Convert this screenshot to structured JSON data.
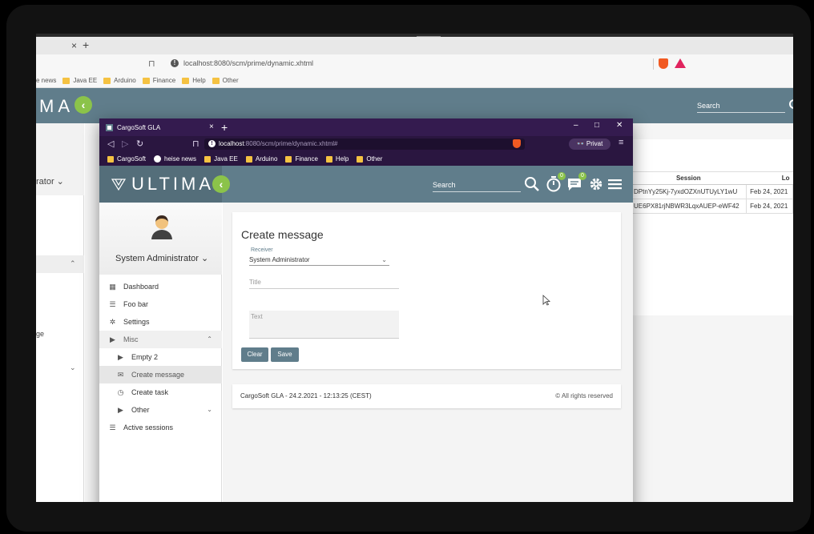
{
  "background_browser": {
    "tab_close": "×",
    "tab_add": "+",
    "url": "localhost:8080/scm/prime/dynamic.xhtml",
    "bookmarks": [
      "e news",
      "Java EE",
      "Arduino",
      "Finance",
      "Help",
      "Other"
    ],
    "logo": "MA",
    "search_label": "Search",
    "sidebar_user": "rator",
    "sidebar_ge": "ge",
    "session_table": {
      "headers": [
        "Session",
        "Lo"
      ],
      "rows": [
        [
          "DPtnYy25Kj-7yxdOZXnUTUyLY1wU",
          "Feb 24, 2021"
        ],
        [
          "UE6PX81rjNBWR3LqxAUEP-eWF42",
          "Feb 24, 2021"
        ]
      ]
    }
  },
  "window": {
    "tab_title": "CargoSoft GLA",
    "tab_close": "×",
    "tab_add": "+",
    "controls": [
      "–",
      "□",
      "✕"
    ],
    "url_host": "localhost",
    "url_path": ":8080/scm/prime/dynamic.xhtml#",
    "privat_label": "Privat",
    "bookmarks": [
      {
        "label": "CargoSoft",
        "icon": "folder"
      },
      {
        "label": "heise news",
        "icon": "circle"
      },
      {
        "label": "Java EE",
        "icon": "folder"
      },
      {
        "label": "Arduino",
        "icon": "folder"
      },
      {
        "label": "Finance",
        "icon": "folder"
      },
      {
        "label": "Help",
        "icon": "folder"
      },
      {
        "label": "Other",
        "icon": "folder"
      }
    ]
  },
  "app": {
    "logo": "ULTIMA",
    "search_label": "Search",
    "timer_badge": "0",
    "messages_badge": "0",
    "user_name": "System Administrator",
    "menu": [
      {
        "label": "Dashboard",
        "icon": "dashboard-icon"
      },
      {
        "label": "Foo bar",
        "icon": "list-icon"
      },
      {
        "label": "Settings",
        "icon": "gear-icon"
      },
      {
        "label": "Misc",
        "icon": "label-icon"
      },
      {
        "label": "Empty 2",
        "icon": "label-icon"
      },
      {
        "label": "Create message",
        "icon": "mail-icon"
      },
      {
        "label": "Create task",
        "icon": "clock-icon"
      },
      {
        "label": "Other",
        "icon": "label-icon"
      },
      {
        "label": "Active sessions",
        "icon": "list-icon"
      }
    ],
    "form": {
      "title": "Create message",
      "receiver_label": "Receiver",
      "receiver_value": "System Administrator",
      "title_placeholder": "Title",
      "text_placeholder": "Text",
      "clear_label": "Clear",
      "save_label": "Save"
    },
    "footer": {
      "left": "CargoSoft GLA - 24.2.2021 - 12:13:25 (CEST)",
      "right": "All rights reserved"
    }
  },
  "colors": {
    "header": "#607d8b",
    "accent": "#8bc34a",
    "browser_chrome": "#341b4f"
  }
}
